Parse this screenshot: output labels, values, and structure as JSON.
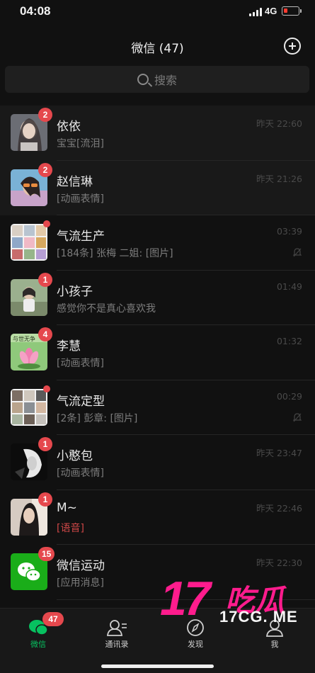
{
  "status_bar": {
    "time": "04:08",
    "network": "4G",
    "battery_color": "#ff3b30"
  },
  "header": {
    "title": "微信 (47)",
    "add_icon": "plus-circle-icon"
  },
  "search": {
    "placeholder": "搜索",
    "icon": "search-icon"
  },
  "chats": [
    {
      "name": "依依",
      "preview": "宝宝[流泪]",
      "time": "昨天 22:60",
      "badge": "2",
      "pinned": true
    },
    {
      "name": "赵信琳",
      "preview": "[动画表情]",
      "time": "昨天 21:26",
      "badge": "2",
      "pinned": true
    },
    {
      "name": "气流生产",
      "preview": "[184条] 张梅 二姐: [图片]",
      "time": "03:39",
      "dot": true,
      "muted": true
    },
    {
      "name": "小孩子",
      "preview": "感觉你不是真心喜欢我",
      "time": "01:49",
      "badge": "1"
    },
    {
      "name": "李慧",
      "preview": "[动画表情]",
      "time": "01:32",
      "badge": "4",
      "avatar_text": "与世无争"
    },
    {
      "name": "气流定型",
      "preview": "[2条] 彭章: [图片]",
      "time": "00:29",
      "dot": true,
      "muted": true
    },
    {
      "name": "小憨包",
      "preview": "[动画表情]",
      "time": "昨天 23:47",
      "badge": "1"
    },
    {
      "name": "M~",
      "preview": "[语音]",
      "time": "昨天 22:46",
      "badge": "1",
      "voice": true
    },
    {
      "name": "微信运动",
      "preview": "[应用消息]",
      "time": "昨天 22:30",
      "badge": "15"
    }
  ],
  "tabs": [
    {
      "label": "微信",
      "icon": "chat-bubbles-icon",
      "badge": "47",
      "active": true
    },
    {
      "label": "通讯录",
      "icon": "contacts-icon"
    },
    {
      "label": "发现",
      "icon": "compass-icon"
    },
    {
      "label": "我",
      "icon": "person-icon"
    }
  ],
  "watermark": {
    "brand_number": "17",
    "brand_cn": "吃瓜",
    "site": "17CG. ME"
  },
  "colors": {
    "accent_green": "#07c160",
    "badge_red": "#e5484d",
    "watermark_pink": "#ff1c8d"
  }
}
